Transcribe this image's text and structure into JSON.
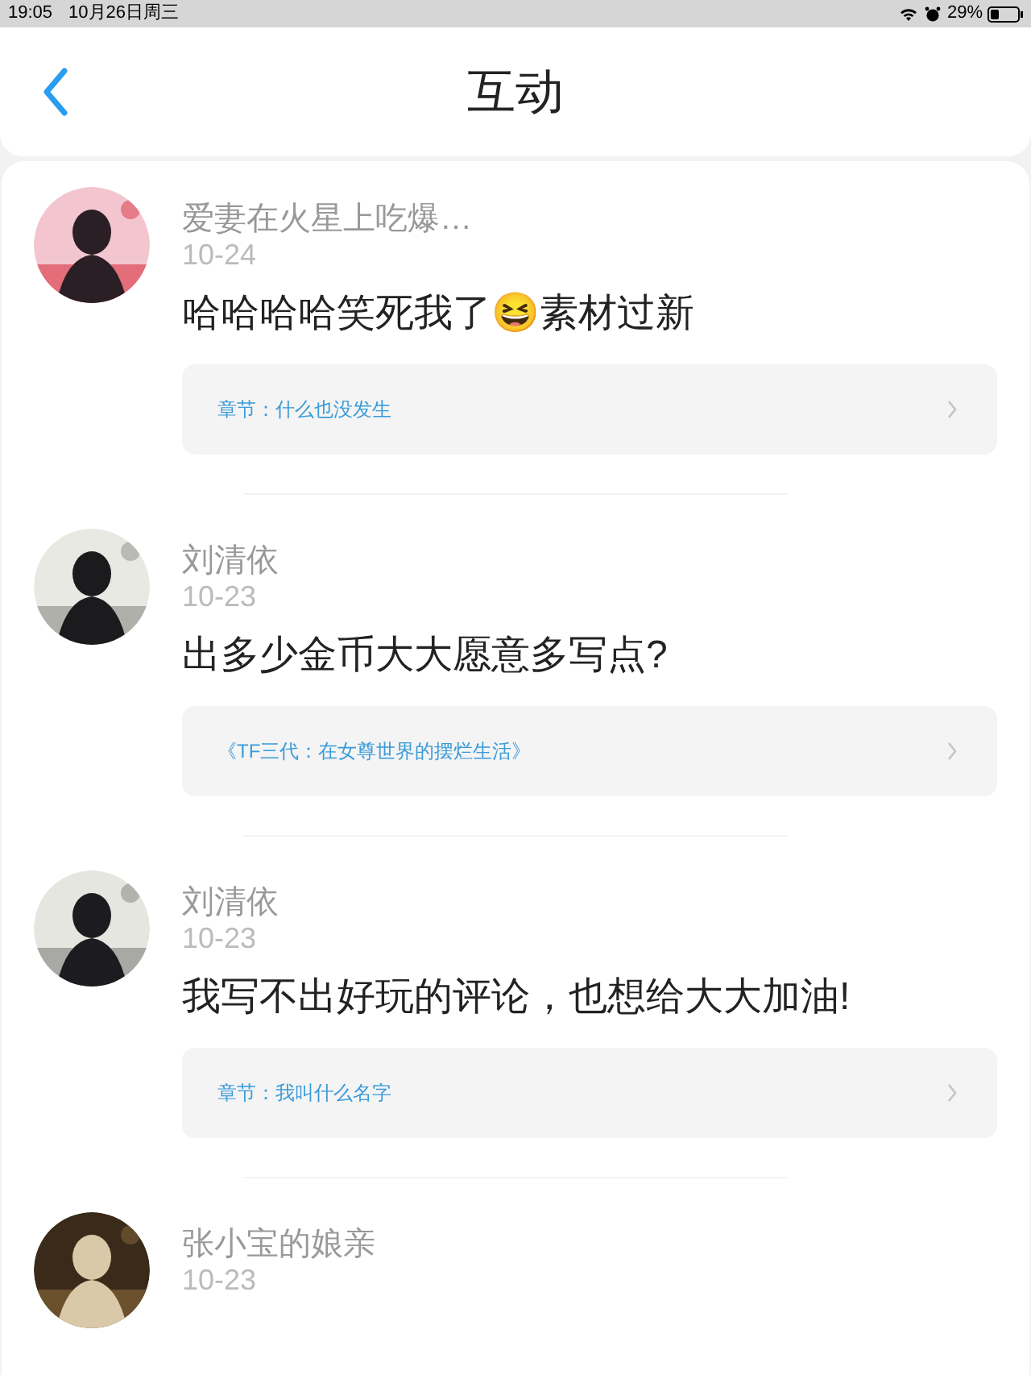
{
  "status_bar": {
    "time": "19:05",
    "date": "10月26日周三",
    "battery": "29%"
  },
  "header": {
    "title": "互动"
  },
  "comments": [
    {
      "user": "爱妻在火星上吃爆…",
      "date": "10-24",
      "text": "哈哈哈哈笑死我了😆素材过新",
      "link": "章节：什么也没发生"
    },
    {
      "user": "刘清依",
      "date": "10-23",
      "text": "出多少金币大大愿意多写点?",
      "link": "《TF三代：在女尊世界的摆烂生活》"
    },
    {
      "user": "刘清依",
      "date": "10-23",
      "text": "我写不出好玩的评论，也想给大大加油!",
      "link": "章节：我叫什么名字"
    },
    {
      "user": "张小宝的娘亲",
      "date": "10-23"
    }
  ]
}
